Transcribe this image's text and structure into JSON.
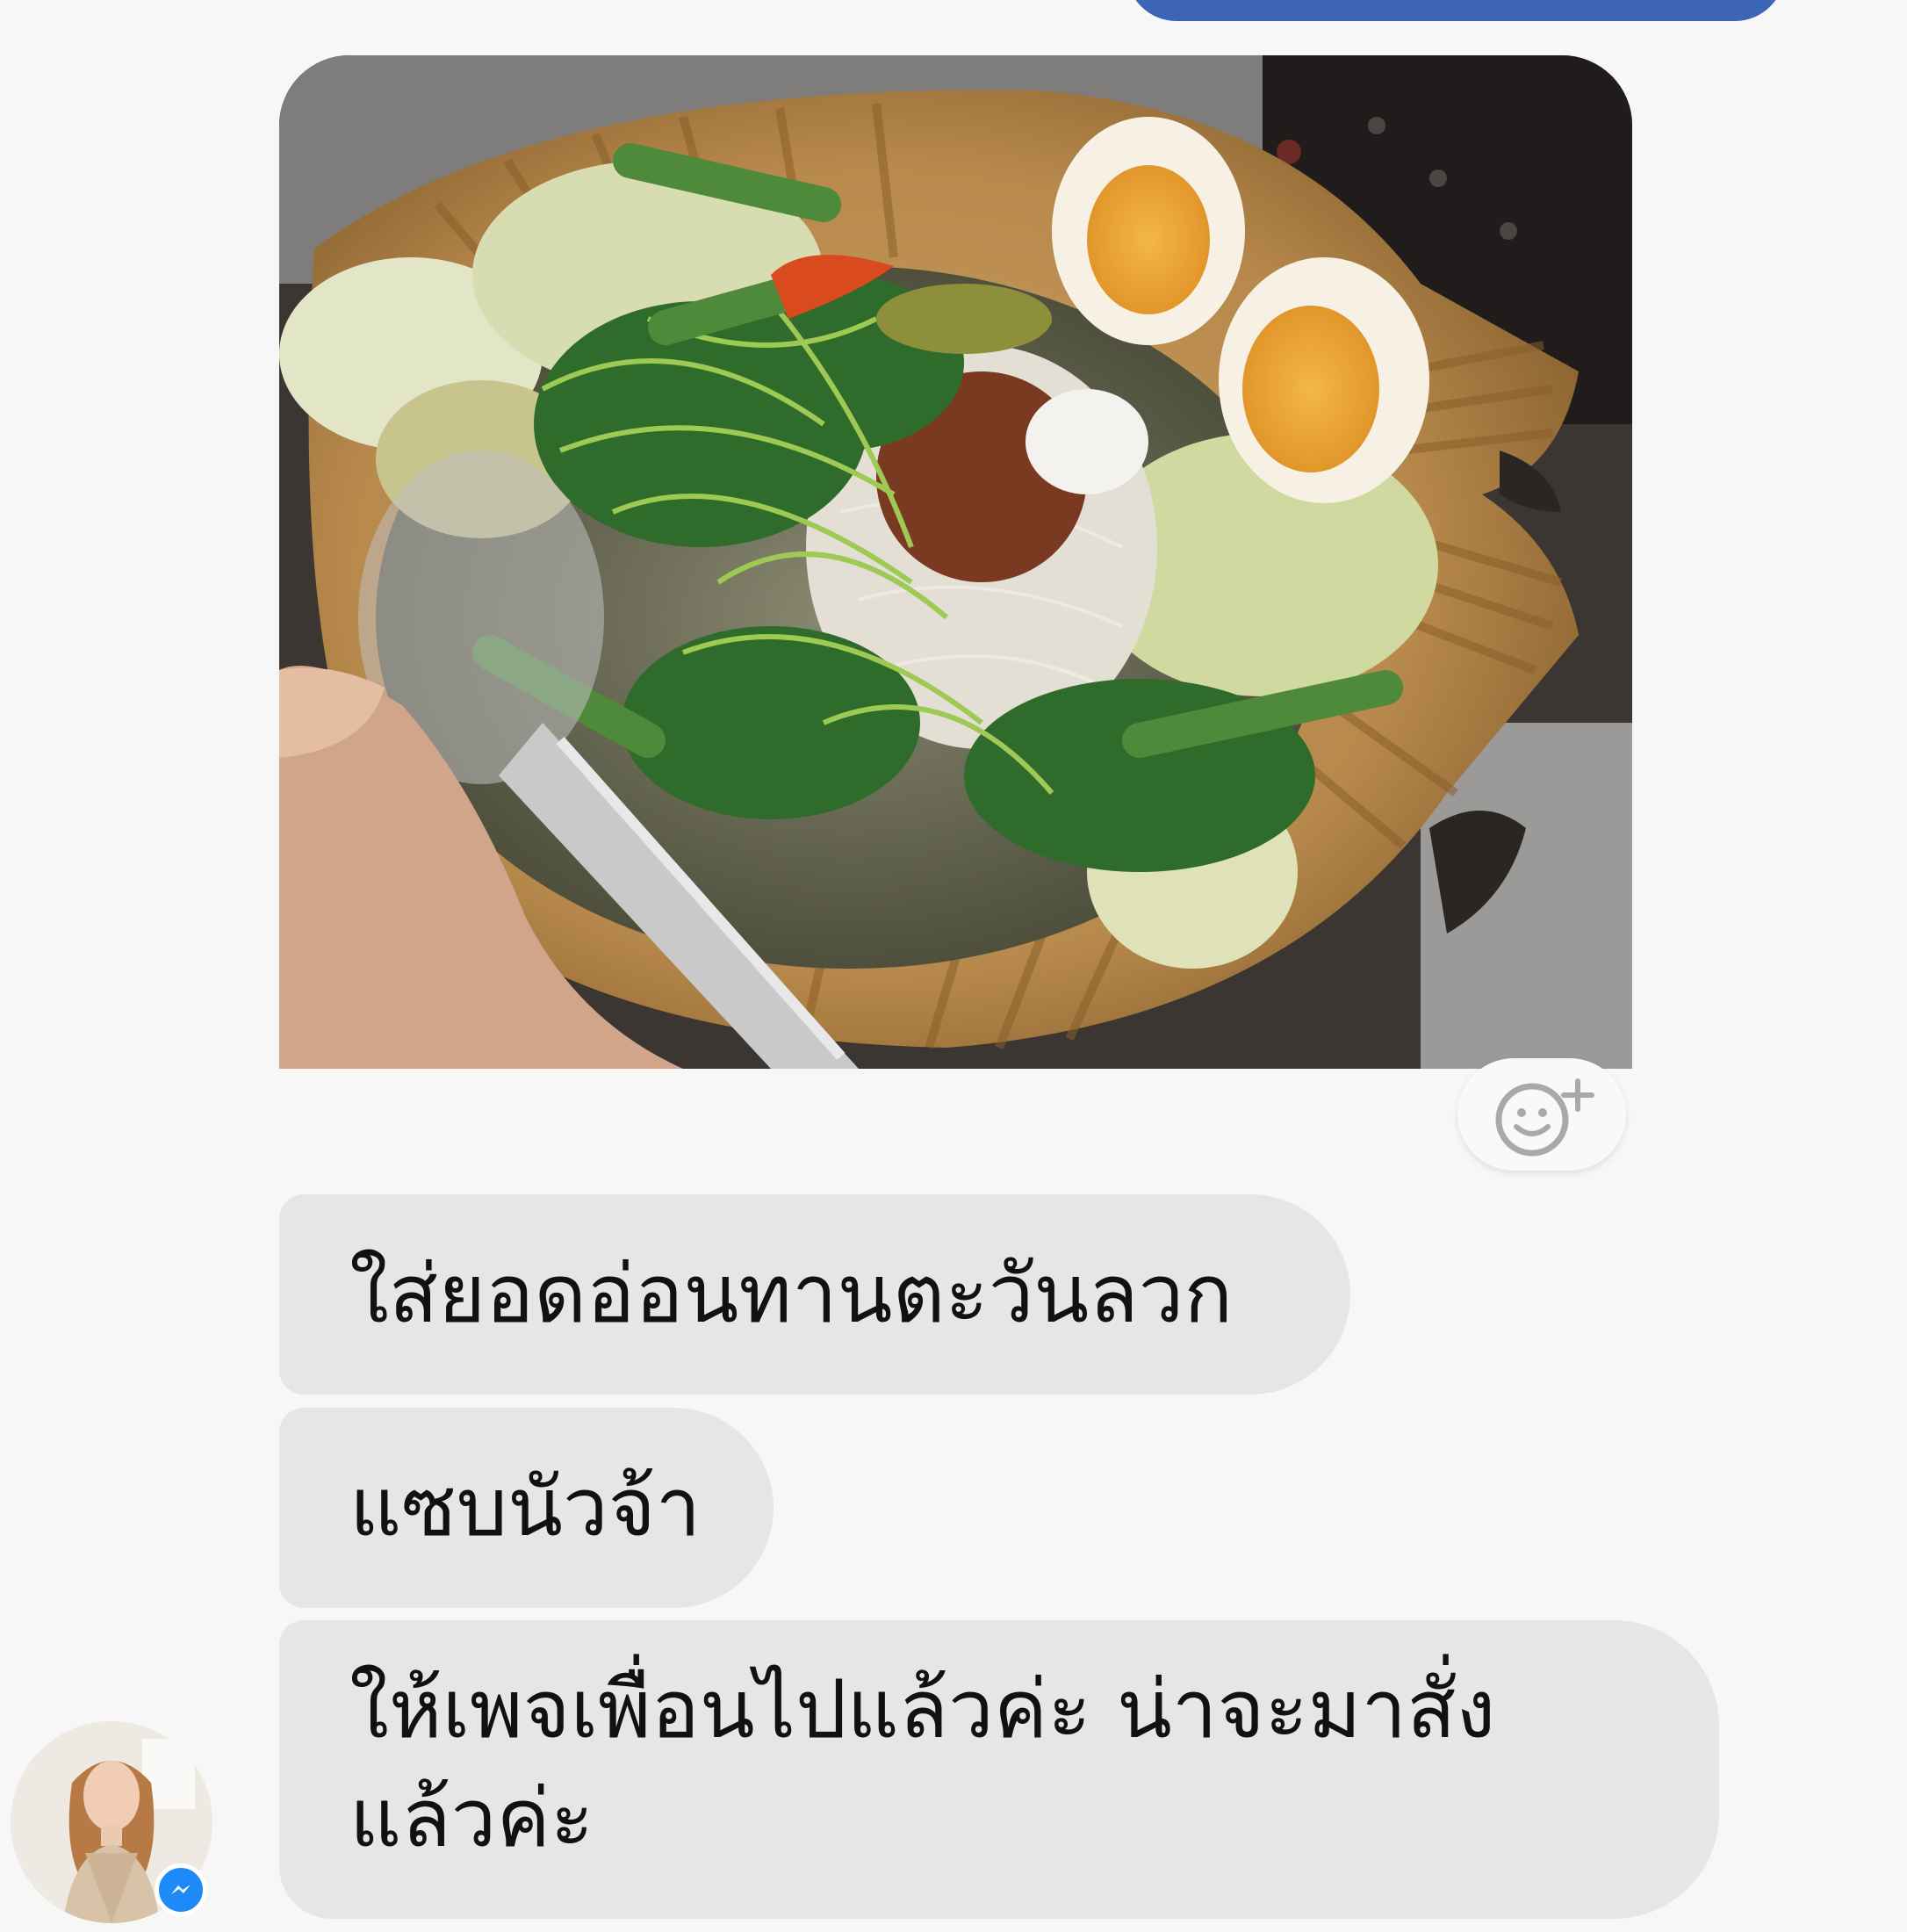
{
  "conversation": {
    "sent_bubble": {
      "color": "#3c66b5"
    },
    "photo": {
      "description_icon": "food-photo"
    },
    "reaction_button": {
      "icon": "add-reaction-icon"
    },
    "messages": [
      {
        "text": "ใส่ยอดอ่อนทานตะวันลวก"
      },
      {
        "text": "แซบนัวจ้า"
      },
      {
        "lines": [
          "ให้เพจเพื่อนไปแล้วค่ะ น่าจะมาสั่ง",
          "แล้วค่ะ"
        ]
      }
    ],
    "sender": {
      "avatar_icon": "avatar",
      "badge_icon": "messenger-icon"
    },
    "colors": {
      "background": "#f7f7f7",
      "bubble_gray": "#e6e6e6",
      "messenger_blue": "#1e8af7"
    }
  }
}
